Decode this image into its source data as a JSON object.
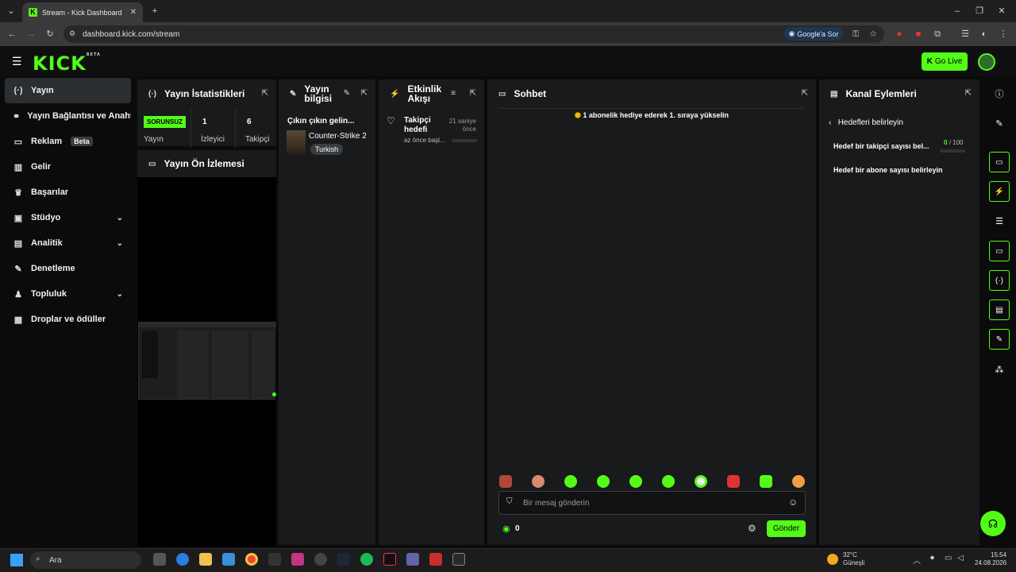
{
  "browser": {
    "tab_title": "Stream - Kick Dashboard",
    "url": "dashboard.kick.com/stream",
    "ask_google": "Google'a Sor"
  },
  "topnav": {
    "logo": "KICK",
    "logo_sup": "BETA",
    "go_live": "Go Live"
  },
  "sidebar": {
    "items": [
      {
        "label": "Yayın",
        "icon": "broadcast-icon"
      },
      {
        "label": "Yayın Bağlantısı ve Anahtar",
        "icon": "link-icon"
      },
      {
        "label": "Reklam",
        "icon": "ad-icon",
        "badge": "Beta"
      },
      {
        "label": "Gelir",
        "icon": "chart-icon"
      },
      {
        "label": "Başarılar",
        "icon": "trophy-icon"
      },
      {
        "label": "Stüdyo",
        "icon": "studio-icon"
      },
      {
        "label": "Analitik",
        "icon": "analytics-icon"
      },
      {
        "label": "Denetleme",
        "icon": "wrench-icon"
      },
      {
        "label": "Topluluk",
        "icon": "community-icon"
      },
      {
        "label": "Droplar ve ödüller",
        "icon": "gift-icon"
      }
    ]
  },
  "stats": {
    "title": "Yayın İstatistikleri",
    "status_badge": "SORUNSUZ",
    "status_label": "Yayın",
    "viewers_value": "1",
    "viewers_label": "İzleyici",
    "followers_value": "6",
    "followers_label": "Takipçi"
  },
  "preview": {
    "title": "Yayın Ön İzlemesi"
  },
  "info": {
    "title_line1": "Yayın",
    "title_line2": "bilgisi",
    "stream_title": "Çıkın çıkın gelin...",
    "game": "Counter-Strike 2",
    "tag": "Turkish"
  },
  "activity": {
    "title_line1": "Etkinlik",
    "title_line2": "Akışı",
    "event_line1": "Takipçi",
    "event_line2": "hedefi",
    "event_time1": "21 saniye",
    "event_time2": "önce",
    "event_sub": "az önce başl..."
  },
  "chat": {
    "title": "Sohbet",
    "banner": "1 abonelik hediye ederek 1. sıraya yükselin",
    "placeholder": "Bir mesaj gönderin",
    "points": "0",
    "send": "Gönder"
  },
  "channel": {
    "title": "Kanal Eylemleri",
    "back_label": "Hedefleri belirleyin",
    "goal1": "Hedef bir takipçi sayısı bel...",
    "goal1_current": "0",
    "goal1_total": "/ 100",
    "goal2": "Hedef bir abone sayısı belirleyin"
  },
  "taskbar": {
    "search": "Ara",
    "weather_temp": "32°C",
    "weather_desc": "Güneşli",
    "time": "15:54",
    "date": "24.08.2026"
  },
  "colors": {
    "accent": "#53fc18",
    "panel": "#181a1b",
    "background": "#0b0b0b"
  }
}
